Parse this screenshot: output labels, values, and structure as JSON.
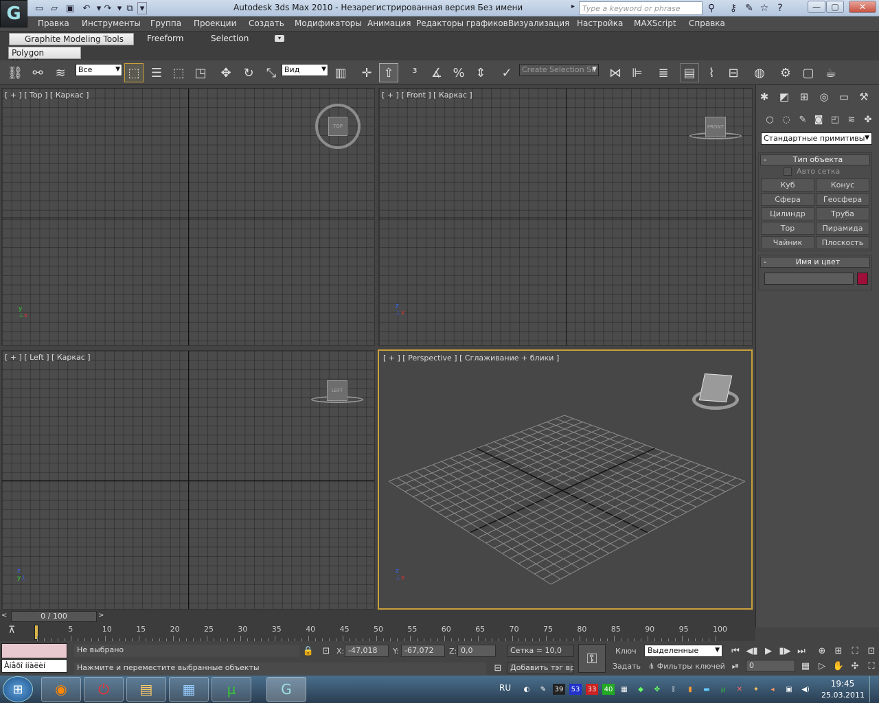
{
  "window": {
    "title": "Autodesk 3ds Max  2010  -  Незарегистрированная версия       Без имени",
    "search_placeholder": "Type a keyword or phrase"
  },
  "menu": [
    "Правка",
    "Инструменты",
    "Группа",
    "Проекции",
    "Создать",
    "Модификаторы",
    "Анимация",
    "Редакторы графиков",
    "Визуализация",
    "Настройка",
    "MAXScript",
    "Справка"
  ],
  "ribbon": {
    "tabs": [
      "Graphite Modeling Tools",
      "Freeform",
      "Selection"
    ],
    "sub_tab": "Polygon Modeling"
  },
  "toolbar": {
    "filter_select": "Все",
    "refcoord_select": "Вид",
    "named_selection": "Create Selection Se"
  },
  "viewports": {
    "top": {
      "label": "[ + ] [ Top ] [ Каркас ]",
      "cube": "TOP"
    },
    "front": {
      "label": "[ + ] [ Front ] [ Каркас ]",
      "cube": "FRONT"
    },
    "left": {
      "label": "[ + ] [ Left ] [ Каркас ]",
      "cube": "LEFT"
    },
    "perspective": {
      "label": "[ + ] [ Perspective ] [ Сглаживание + блики ]"
    }
  },
  "command_panel": {
    "category_select": "Стандартные примитивы",
    "object_type": {
      "title": "Тип объекта",
      "autogrid": "Авто сетка",
      "buttons": [
        "Куб",
        "Конус",
        "Сфера",
        "Геосфера",
        "Цилиндр",
        "Труба",
        "Тор",
        "Пирамида",
        "Чайник",
        "Плоскость"
      ]
    },
    "name_color": {
      "title": "Имя и цвет",
      "name_value": "",
      "color": "#9e0f3a"
    }
  },
  "timeline": {
    "frame_display": "0 / 100",
    "labels": [
      "0",
      "5",
      "10",
      "15",
      "20",
      "25",
      "30",
      "35",
      "40",
      "45",
      "50",
      "55",
      "60",
      "65",
      "70",
      "75",
      "80",
      "85",
      "90",
      "95",
      "100"
    ]
  },
  "status": {
    "maxscript_text": "Àíåðî ííàëèí",
    "selection": "Не выбрано",
    "prompt": "Нажмите и переместите выбранные объекты",
    "x_label": "X:",
    "x": "-47,018",
    "y_label": "Y:",
    "y": "-67,072",
    "z_label": "Z:",
    "z": "0,0",
    "grid": "Сетка = 10,0",
    "add_tag": "Добавить тэг врем",
    "key_label": "Ключ",
    "set_label": "Задать",
    "key_mode": "Выделенные",
    "key_filters": "Фильтры ключей",
    "frame_field": "0"
  },
  "taskbar": {
    "lang": "RU",
    "time": "19:45",
    "date": "25.03.2011",
    "tray_numbers": [
      "39",
      "53",
      "33",
      "40"
    ]
  }
}
